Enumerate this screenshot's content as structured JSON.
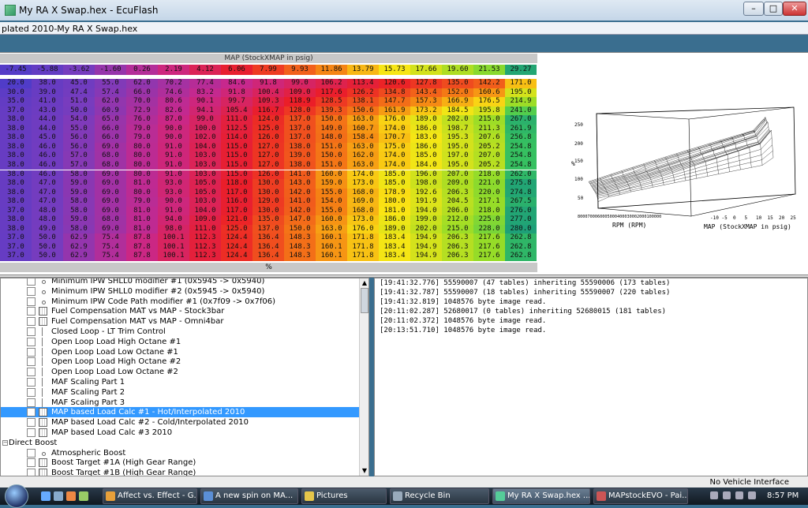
{
  "window": {
    "title": "My RA X Swap.hex - EcuFlash",
    "min": "–",
    "max": "□",
    "close": "✕"
  },
  "subwindow": {
    "title": "plated 2010-My RA X Swap.hex"
  },
  "map": {
    "header": "MAP (StockXMAP in psig)",
    "footer": "%",
    "x_axis": [
      "-7.45",
      "-5.88",
      "-3.62",
      "-1.60",
      "0.26",
      "2.19",
      "4.12",
      "6.06",
      "7.99",
      "9.93",
      "11.86",
      "13.79",
      "15.73",
      "17.66",
      "19.60",
      "21.53",
      "29.27"
    ],
    "rows": [
      [
        "20.0",
        "38.0",
        "45.0",
        "55.0",
        "62.0",
        "70.2",
        "77.4",
        "84.6",
        "91.8",
        "99.0",
        "106.2",
        "113.4",
        "120.6",
        "127.8",
        "135.0",
        "142.2",
        "171.0"
      ],
      [
        "30.0",
        "39.0",
        "47.4",
        "57.4",
        "66.0",
        "74.6",
        "83.2",
        "91.8",
        "100.4",
        "109.0",
        "117.6",
        "126.2",
        "134.8",
        "143.4",
        "152.0",
        "160.6",
        "195.0"
      ],
      [
        "35.0",
        "41.0",
        "51.0",
        "62.0",
        "70.0",
        "80.6",
        "90.1",
        "99.7",
        "109.3",
        "118.9",
        "128.5",
        "138.1",
        "147.7",
        "157.3",
        "166.9",
        "176.5",
        "214.9"
      ],
      [
        "37.0",
        "43.0",
        "50.0",
        "60.9",
        "72.9",
        "82.6",
        "94.1",
        "105.4",
        "116.7",
        "128.0",
        "139.3",
        "150.6",
        "161.9",
        "173.2",
        "184.5",
        "195.8",
        "241.0"
      ],
      [
        "38.0",
        "44.0",
        "54.0",
        "65.0",
        "76.0",
        "87.0",
        "99.0",
        "111.0",
        "124.0",
        "137.0",
        "150.0",
        "163.0",
        "176.0",
        "189.0",
        "202.0",
        "215.0",
        "267.0"
      ],
      [
        "38.0",
        "44.0",
        "55.0",
        "66.0",
        "79.0",
        "90.0",
        "100.0",
        "112.5",
        "125.0",
        "137.0",
        "149.0",
        "160.7",
        "174.0",
        "186.0",
        "198.7",
        "211.3",
        "261.9"
      ],
      [
        "38.0",
        "45.0",
        "56.0",
        "66.0",
        "79.0",
        "90.0",
        "102.0",
        "114.0",
        "126.0",
        "137.0",
        "148.0",
        "158.4",
        "170.7",
        "183.0",
        "195.3",
        "207.6",
        "256.8"
      ],
      [
        "38.0",
        "46.0",
        "56.0",
        "69.0",
        "80.0",
        "91.0",
        "104.0",
        "115.0",
        "127.0",
        "138.0",
        "151.0",
        "163.0",
        "175.0",
        "186.0",
        "195.0",
        "205.2",
        "254.8"
      ],
      [
        "38.0",
        "46.0",
        "57.0",
        "68.0",
        "80.0",
        "91.0",
        "103.0",
        "115.0",
        "127.0",
        "139.0",
        "150.0",
        "162.0",
        "174.0",
        "185.0",
        "197.0",
        "207.0",
        "254.8"
      ],
      [
        "38.0",
        "46.0",
        "57.0",
        "68.0",
        "80.0",
        "91.0",
        "103.0",
        "115.0",
        "127.0",
        "138.0",
        "151.0",
        "163.0",
        "174.0",
        "184.0",
        "195.0",
        "205.2",
        "254.8"
      ],
      [
        "38.0",
        "46.0",
        "58.0",
        "69.0",
        "80.0",
        "91.0",
        "103.0",
        "115.0",
        "126.0",
        "141.0",
        "160.0",
        "174.0",
        "185.0",
        "196.0",
        "207.0",
        "218.0",
        "262.0"
      ],
      [
        "38.0",
        "47.0",
        "59.0",
        "69.0",
        "81.0",
        "93.0",
        "105.0",
        "118.0",
        "130.0",
        "143.0",
        "159.0",
        "173.0",
        "185.0",
        "198.0",
        "209.0",
        "221.0",
        "275.8"
      ],
      [
        "38.0",
        "47.0",
        "59.0",
        "69.0",
        "80.0",
        "93.0",
        "105.0",
        "117.0",
        "130.0",
        "142.0",
        "155.0",
        "168.0",
        "178.9",
        "192.6",
        "206.3",
        "220.0",
        "274.8"
      ],
      [
        "38.0",
        "47.0",
        "58.0",
        "69.0",
        "79.0",
        "90.0",
        "103.0",
        "116.0",
        "129.0",
        "141.0",
        "154.0",
        "169.0",
        "180.0",
        "191.9",
        "204.5",
        "217.1",
        "267.5"
      ],
      [
        "37.0",
        "48.0",
        "58.0",
        "69.0",
        "81.0",
        "91.0",
        "104.0",
        "117.0",
        "130.0",
        "142.0",
        "155.0",
        "168.0",
        "181.0",
        "194.0",
        "206.0",
        "218.0",
        "276.0"
      ],
      [
        "38.0",
        "48.0",
        "59.0",
        "68.0",
        "81.0",
        "94.0",
        "109.0",
        "121.0",
        "135.0",
        "147.0",
        "160.0",
        "173.0",
        "186.0",
        "199.0",
        "212.0",
        "225.0",
        "277.0"
      ],
      [
        "38.0",
        "49.0",
        "58.0",
        "69.0",
        "81.0",
        "98.0",
        "111.0",
        "125.0",
        "137.0",
        "150.0",
        "163.0",
        "176.0",
        "189.0",
        "202.0",
        "215.0",
        "228.0",
        "280.0"
      ],
      [
        "37.0",
        "50.0",
        "62.9",
        "75.4",
        "87.8",
        "100.1",
        "112.3",
        "124.4",
        "136.4",
        "148.3",
        "160.1",
        "171.8",
        "183.4",
        "194.9",
        "206.3",
        "217.6",
        "262.8"
      ],
      [
        "37.0",
        "50.0",
        "62.9",
        "75.4",
        "87.8",
        "100.1",
        "112.3",
        "124.4",
        "136.4",
        "148.3",
        "160.1",
        "171.8",
        "183.4",
        "194.9",
        "206.3",
        "217.6",
        "262.8"
      ],
      [
        "37.0",
        "50.0",
        "62.9",
        "75.4",
        "87.8",
        "100.1",
        "112.3",
        "124.4",
        "136.4",
        "148.3",
        "160.1",
        "171.8",
        "183.4",
        "194.9",
        "206.3",
        "217.6",
        "262.8"
      ]
    ],
    "color_min": 20,
    "color_max": 280
  },
  "plot": {
    "z_ticks": [
      "250",
      "200",
      "150",
      "100",
      "50"
    ],
    "z_label": "%",
    "x_ticks": [
      "-10",
      "-5",
      "0",
      "5",
      "10",
      "15",
      "20",
      "25"
    ],
    "rpm_ticks": "8000700060005000400030002000100000",
    "rpm_label": "RPM (RPM)",
    "map_label": "MAP (StockXMAP in psig)"
  },
  "tree": {
    "items": [
      {
        "label": "Minimum IPW SHLL0 modifier #1 (0x5945 -> 0x5940)",
        "icon": "dot",
        "checked": false
      },
      {
        "label": "Minimum IPW SHLL0 modifier #2 (0x5945 -> 0x5940)",
        "icon": "dot",
        "checked": false
      },
      {
        "label": "Minimum IPW Code Path modifier #1 (0x7f09 -> 0x7f06)",
        "icon": "dot",
        "checked": false
      },
      {
        "label": "Fuel Compensation MAT vs MAP - Stock3bar",
        "icon": "grid",
        "checked": false
      },
      {
        "label": "Fuel Compensation MAT vs MAP - Omni4bar",
        "icon": "grid",
        "checked": false
      },
      {
        "label": "Closed Loop - LT Trim Control",
        "icon": "line",
        "checked": false
      },
      {
        "label": "Open Loop Load High Octane #1",
        "icon": "line",
        "checked": false
      },
      {
        "label": "Open Loop Load Low Octane #1",
        "icon": "line",
        "checked": false
      },
      {
        "label": "Open Loop Load High Octane #2",
        "icon": "line",
        "checked": false
      },
      {
        "label": "Open Loop Load Low Octane #2",
        "icon": "line",
        "checked": false
      },
      {
        "label": "MAF Scaling Part 1",
        "icon": "line",
        "checked": false
      },
      {
        "label": "MAF Scaling Part 2",
        "icon": "line",
        "checked": false
      },
      {
        "label": "MAF Scaling Part 3",
        "icon": "line",
        "checked": false
      },
      {
        "label": "MAP based Load Calc #1 - Hot/Interpolated 2010",
        "icon": "grid",
        "checked": true,
        "selected": true
      },
      {
        "label": "MAP based Load Calc #2 - Cold/Interpolated 2010",
        "icon": "grid",
        "checked": false
      },
      {
        "label": "MAP based Load Calc #3 2010",
        "icon": "grid",
        "checked": false
      },
      {
        "label": "Direct Boost",
        "category": true
      },
      {
        "label": "Atmospheric Boost",
        "icon": "dot",
        "checked": false
      },
      {
        "label": "Boost Target #1A (High Gear Range)",
        "icon": "grid",
        "checked": false
      },
      {
        "label": "Boost Target #1B (High Gear Range)",
        "icon": "grid",
        "checked": false
      }
    ]
  },
  "log": {
    "lines": [
      "[19:41:32.776] 55590007 (47 tables) inheriting 55590006 (173 tables)",
      "[19:41:32.787] 55590007 (18 tables) inheriting 55590007 (220 tables)",
      "[19:41:32.819] 1048576 byte image read.",
      "[20:11:02.287] 52680017 (0 tables) inheriting 52680015 (181 tables)",
      "[20:11:02.372] 1048576 byte image read.",
      "[20:13:51.710] 1048576 byte image read."
    ]
  },
  "status": {
    "text": "No Vehicle Interface"
  },
  "taskbar": {
    "buttons": [
      {
        "label": "Affect vs. Effect - G...",
        "color": "#e8a03a"
      },
      {
        "label": "A new spin on MA...",
        "color": "#5b8fd6"
      },
      {
        "label": "Pictures",
        "color": "#e6c64a"
      },
      {
        "label": "Recycle Bin",
        "color": "#9ab"
      },
      {
        "label": "My RA X Swap.hex ...",
        "color": "#5c9",
        "active": true
      },
      {
        "label": "MAPstockEVO - Pai...",
        "color": "#c55"
      }
    ],
    "clock": "8:57 PM"
  }
}
